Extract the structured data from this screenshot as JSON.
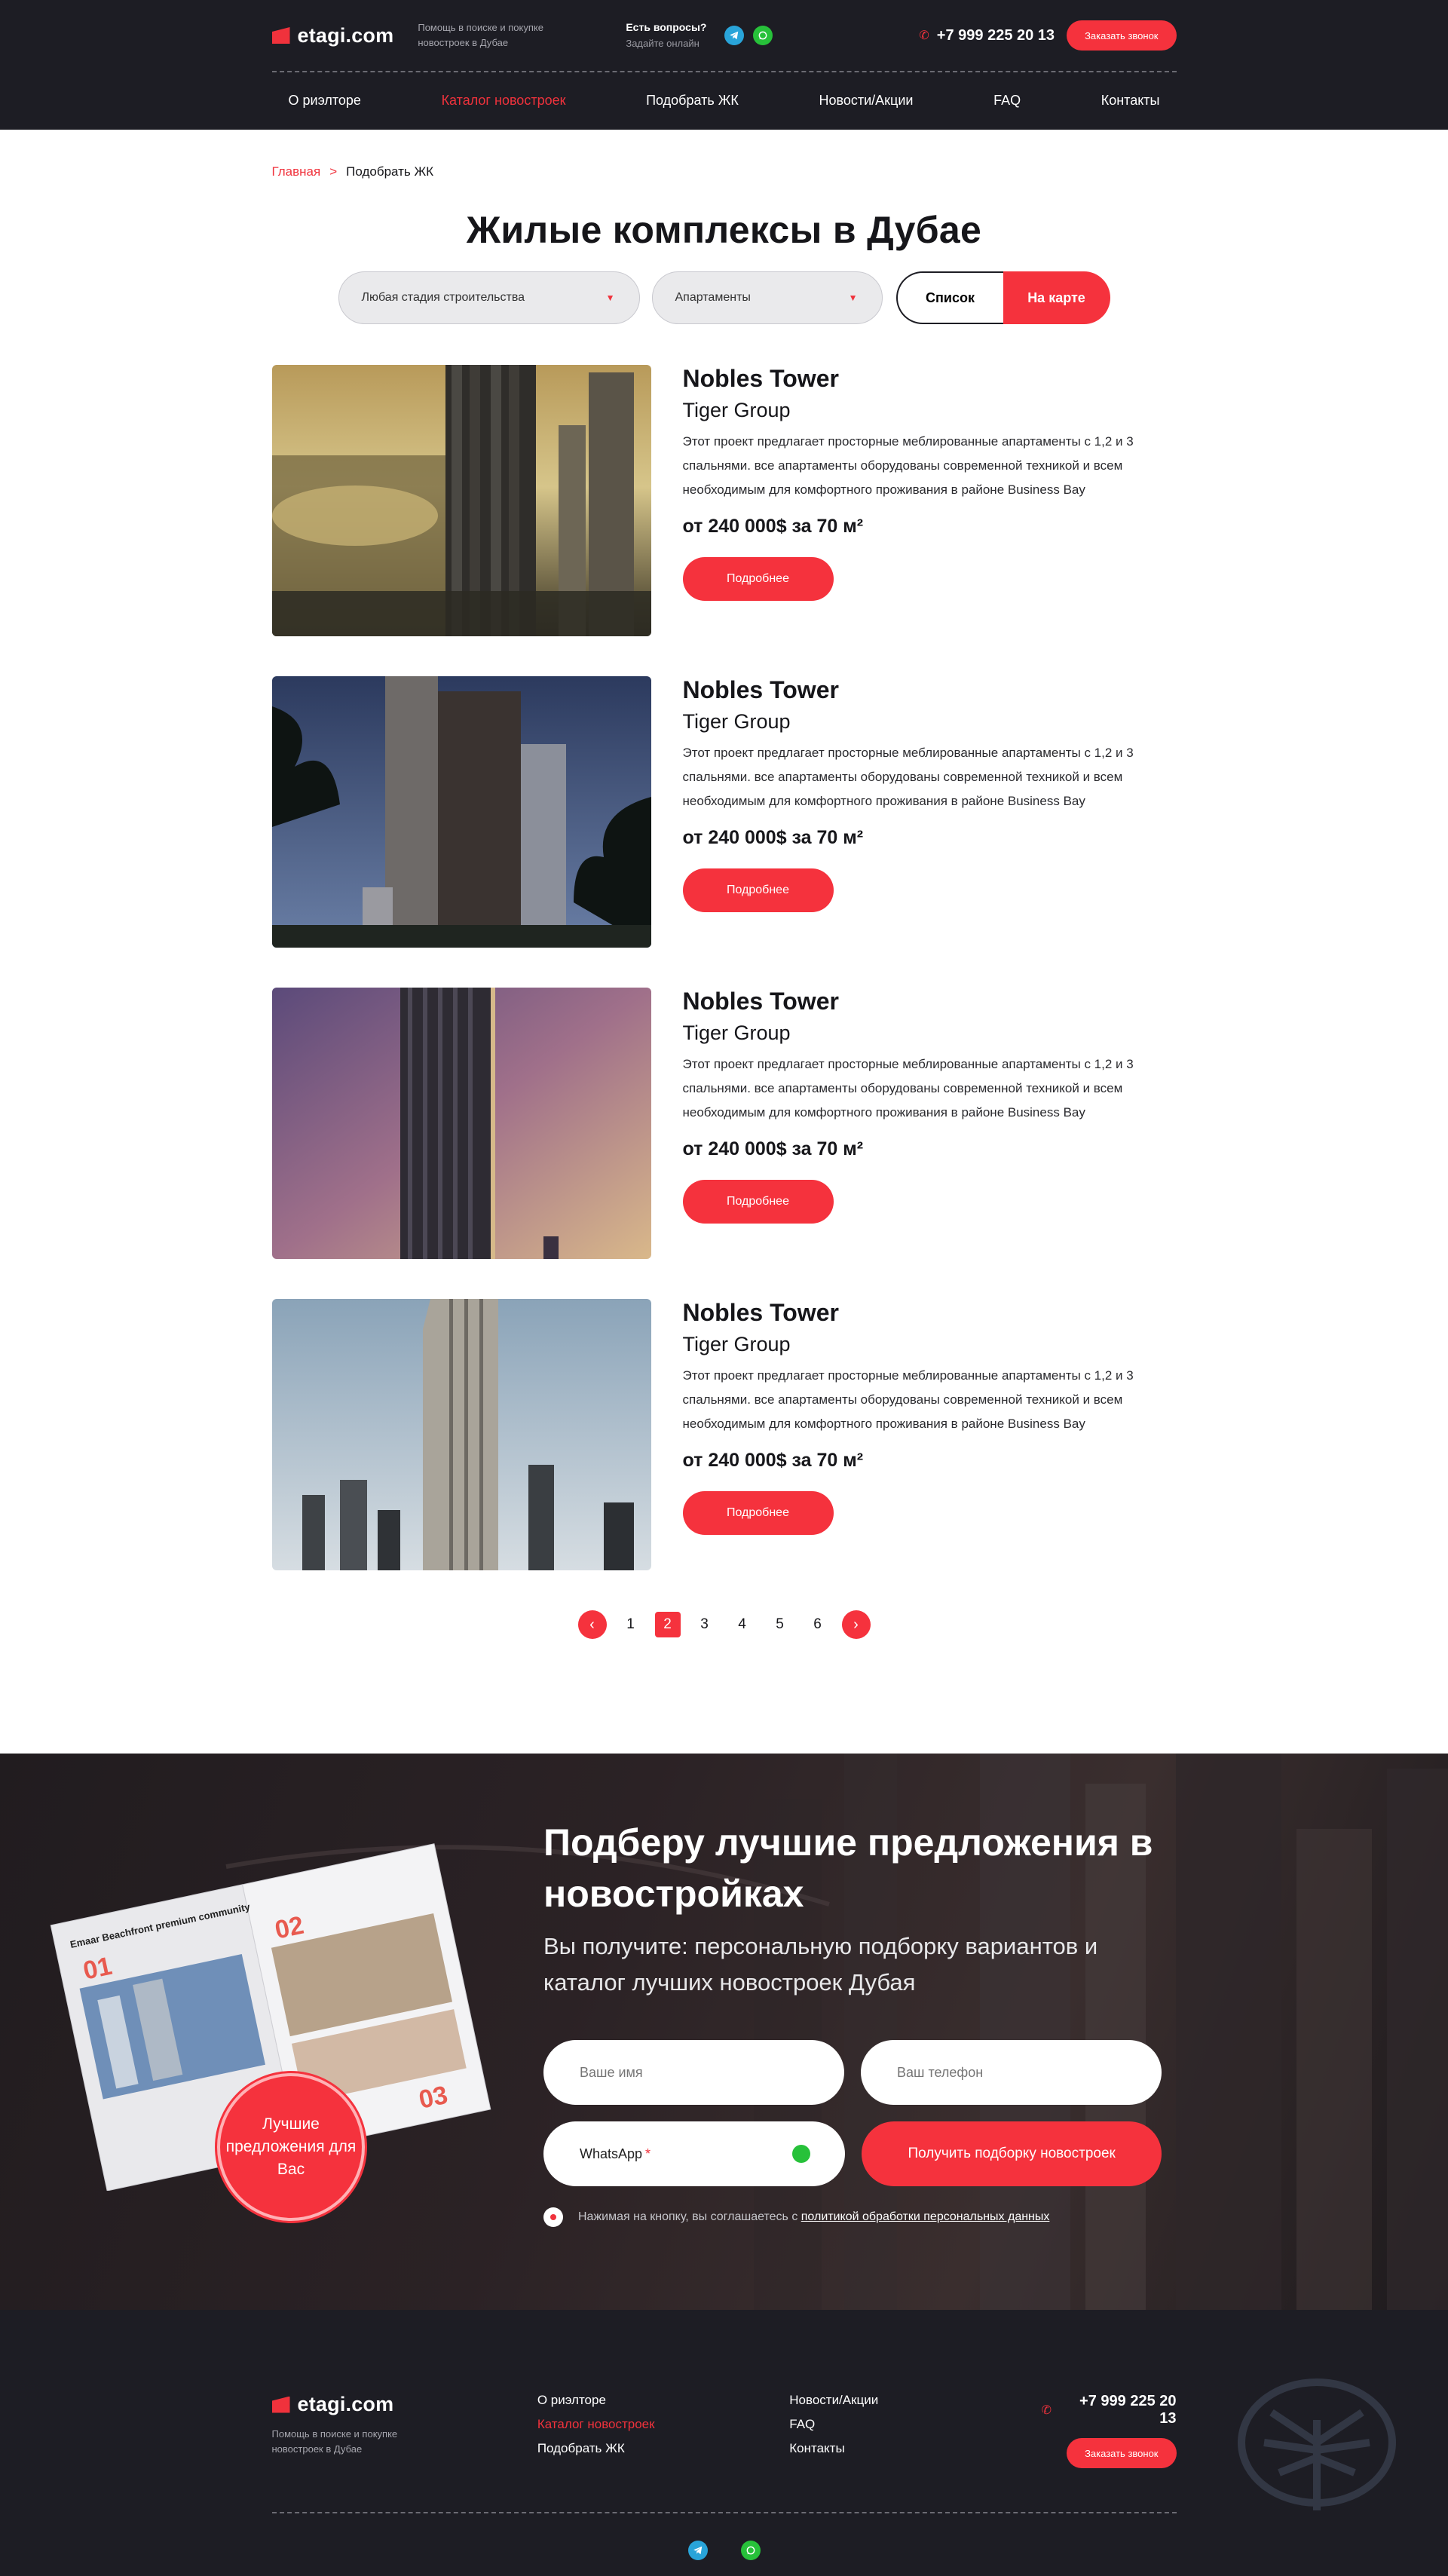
{
  "header": {
    "logo_text": "etagi.com",
    "tagline": "Помощь в поиске и покупке новостроек в Дубае",
    "ask_title": "Есть вопросы?",
    "ask_sub": "Задайте онлайн",
    "phone": "+7 999 225 20 13",
    "callback_label": "Заказать звонок"
  },
  "nav": [
    "О риэлторе",
    "Каталог новостроек",
    "Подобрать  ЖК",
    "Новости/Акции",
    "FAQ",
    "Контакты"
  ],
  "breadcrumb": {
    "home": "Главная",
    "sep": ">",
    "current": "Подобрать ЖК"
  },
  "page_title": "Жилые комплексы в Дубае",
  "filters": {
    "stage": "Любая стадия строительства",
    "type": "Апартаменты",
    "view_list": "Список",
    "view_map": "На карте"
  },
  "listings": [
    {
      "title": "Nobles Tower",
      "developer": "Tiger Group",
      "description": "Этот проект предлагает просторные меблированные апартаменты с 1,2 и 3 спальнями. все апартаменты оборудованы современной техникой и всем необходимым для комфортного проживания в районе Business Bay",
      "price": "от 240 000$ за 70 м²",
      "button": "Подробнее"
    },
    {
      "title": "Nobles Tower",
      "developer": "Tiger Group",
      "description": "Этот проект предлагает просторные меблированные апартаменты с 1,2 и 3 спальнями. все апартаменты оборудованы современной техникой и всем необходимым для комфортного проживания в районе Business Bay",
      "price": "от 240 000$ за 70 м²",
      "button": "Подробнее"
    },
    {
      "title": "Nobles Tower",
      "developer": "Tiger Group",
      "description": "Этот проект предлагает просторные меблированные апартаменты с 1,2 и 3 спальнями. все апартаменты оборудованы современной техникой и всем необходимым для комфортного проживания в районе Business Bay",
      "price": "от 240 000$ за 70 м²",
      "button": "Подробнее"
    },
    {
      "title": "Nobles Tower",
      "developer": "Tiger Group",
      "description": "Этот проект предлагает просторные меблированные апартаменты с 1,2 и 3 спальнями. все апартаменты оборудованы современной техникой и всем необходимым для комфортного проживания в районе Business Bay",
      "price": "от 240 000$ за 70 м²",
      "button": "Подробнее"
    }
  ],
  "pagination": {
    "pages": [
      "1",
      "2",
      "3",
      "4",
      "5",
      "6"
    ],
    "current": "2"
  },
  "promo": {
    "title": "Подберу лучшие предложения в новостройках",
    "subtitle": "Вы получите: персональную подборку вариантов и каталог лучших новостроек Дубая",
    "name_placeholder": "Ваше имя",
    "phone_placeholder": "Ваш телефон",
    "whatsapp_label": "WhatsApp",
    "required_mark": "*",
    "submit_label": "Получить подборку новостроек",
    "consent_text": "Нажимая на кнопку, вы соглашаетесь с ",
    "consent_link": "политикой обработки персональных данных",
    "badge": "Лучшие предложения для Вас",
    "magazine": {
      "title": "Emaar Beachfront premium community",
      "n1": "01",
      "n2": "02",
      "n3": "03"
    }
  },
  "footer": {
    "logo_text": "etagi.com",
    "tagline": "Помощь в поиске и покупке новостроек в Дубае",
    "col1": [
      "О риэлторе",
      "Каталог новостроек",
      "Подобрать  ЖК"
    ],
    "col2": [
      "Новости/Акции",
      "FAQ",
      "Контакты"
    ],
    "phone": "+7 999 225 20 13",
    "callback_label": "Заказать звонок"
  },
  "colors": {
    "accent": "#f5323d",
    "dark": "#1d1d24",
    "telegram": "#29a4d9",
    "whatsapp": "#27c13a"
  }
}
